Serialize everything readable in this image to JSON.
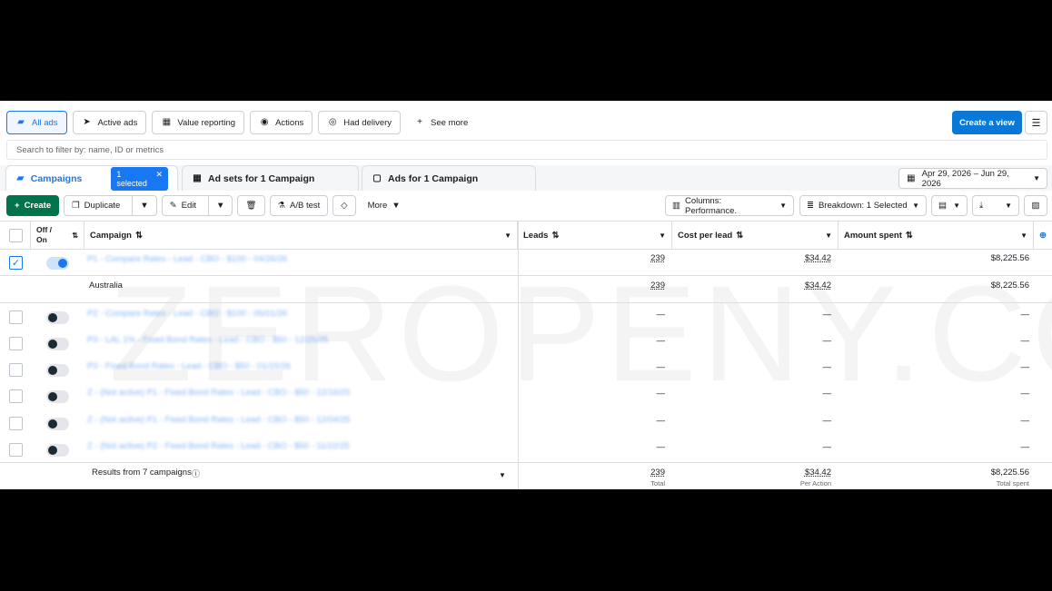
{
  "filters": {
    "all_ads": "All ads",
    "active_ads": "Active ads",
    "value_reporting": "Value reporting",
    "actions": "Actions",
    "had_delivery": "Had delivery",
    "see_more": "See more",
    "create_view": "Create a view"
  },
  "search": {
    "placeholder": "Search to filter by: name, ID or metrics"
  },
  "tabs": {
    "campaigns": "Campaigns",
    "selected_badge": "1 selected",
    "ad_sets": "Ad sets for 1 Campaign",
    "ads": "Ads for 1 Campaign",
    "date_range": "Apr 29, 2026 – Jun 29, 2026"
  },
  "toolbar": {
    "create": "Create",
    "duplicate": "Duplicate",
    "edit": "Edit",
    "ab_test": "A/B test",
    "more": "More",
    "columns": "Columns: Performance.",
    "breakdown": "Breakdown: 1 Selected"
  },
  "table": {
    "headers": {
      "off_on": "Off / On",
      "campaign": "Campaign",
      "leads": "Leads",
      "cost_per_lead": "Cost per lead",
      "amount_spent": "Amount spent"
    },
    "rows": [
      {
        "name": "P1 - Compare Rates - Lead - CBO - $100 - 04/26/26",
        "leads": "239",
        "cpl": "$34.42",
        "spent": "$8,225.56"
      },
      {
        "name": "Australia",
        "leads": "239",
        "cpl": "$34.42",
        "spent": "$8,225.56"
      },
      {
        "name": "P2 - Compare Rates - Lead - CBO - $100 - 05/01/26",
        "leads": "—",
        "cpl": "—",
        "spent": "—"
      },
      {
        "name": "P3 - LAL 1% - Fixed Bond Rates - Lead - CBO - $50 - 12/25/25",
        "leads": "—",
        "cpl": "—",
        "spent": "—"
      },
      {
        "name": "P3 - Fixed Bond Rates - Lead - CBO - $50 - 01/15/26",
        "leads": "—",
        "cpl": "—",
        "spent": "—"
      },
      {
        "name": "Z - (Not active) P1 - Fixed Bond Rates - Lead - CBO - $50 - 12/16/25",
        "leads": "—",
        "cpl": "—",
        "spent": "—"
      },
      {
        "name": "Z - (Not active) P1 - Fixed Bond Rates - Lead - CBO - $50 - 12/04/25",
        "leads": "—",
        "cpl": "—",
        "spent": "—"
      },
      {
        "name": "Z - (Not active) P2 - Fixed Bond Rates - Lead - CBO - $50 - 11/22/25",
        "leads": "—",
        "cpl": "—",
        "spent": "—"
      }
    ],
    "summary": {
      "label": "Results from 7 campaigns",
      "leads": "239",
      "leads_sub": "Total",
      "cpl": "$34.42",
      "cpl_sub": "Per Action",
      "spent": "$8,225.56",
      "spent_sub": "Total spent"
    }
  },
  "watermark": "ZEROPENY.CO",
  "colors": {
    "accent": "#1877f2",
    "create_button": "#00744a",
    "create_view_button": "#0a78d7"
  }
}
